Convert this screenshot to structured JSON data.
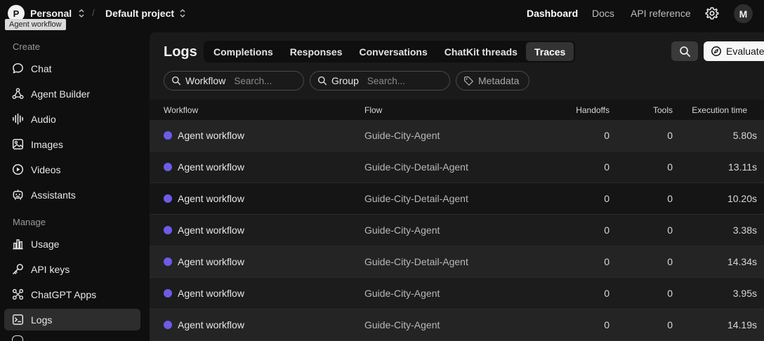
{
  "topbar": {
    "org_initial": "P",
    "org_name": "Personal",
    "project_name": "Default project",
    "tooltip": "Agent workflow",
    "nav": {
      "dashboard": "Dashboard",
      "docs": "Docs",
      "api_reference": "API reference"
    },
    "user_initial": "M"
  },
  "sidebar": {
    "create_title": "Create",
    "create_items": [
      {
        "label": "Chat",
        "icon": "chat-bubble-icon"
      },
      {
        "label": "Agent Builder",
        "icon": "agent-builder-icon"
      },
      {
        "label": "Audio",
        "icon": "audio-wave-icon"
      },
      {
        "label": "Images",
        "icon": "image-icon"
      },
      {
        "label": "Videos",
        "icon": "play-circle-icon"
      },
      {
        "label": "Assistants",
        "icon": "robot-icon"
      }
    ],
    "manage_title": "Manage",
    "manage_items": [
      {
        "label": "Usage",
        "icon": "bar-chart-icon"
      },
      {
        "label": "API keys",
        "icon": "key-icon"
      },
      {
        "label": "ChatGPT Apps",
        "icon": "apps-icon"
      },
      {
        "label": "Logs",
        "icon": "terminal-icon",
        "active": true
      }
    ]
  },
  "main": {
    "title": "Logs",
    "tabs": [
      {
        "label": "Completions"
      },
      {
        "label": "Responses"
      },
      {
        "label": "Conversations"
      },
      {
        "label": "ChatKit threads"
      },
      {
        "label": "Traces",
        "active": true
      }
    ],
    "evaluate_label": "Evaluate",
    "filters": {
      "workflow": {
        "label": "Workflow",
        "placeholder": "Search..."
      },
      "group": {
        "label": "Group",
        "placeholder": "Search..."
      },
      "metadata": {
        "label": "Metadata"
      }
    },
    "columns": {
      "workflow": "Workflow",
      "flow": "Flow",
      "handoffs": "Handoffs",
      "tools": "Tools",
      "execution_time": "Execution time"
    },
    "rows": [
      {
        "workflow": "Agent workflow",
        "flow": "Guide-City-Agent",
        "handoffs": "0",
        "tools": "0",
        "time": "5.80s"
      },
      {
        "workflow": "Agent workflow",
        "flow": "Guide-City-Detail-Agent",
        "handoffs": "0",
        "tools": "0",
        "time": "13.11s"
      },
      {
        "workflow": "Agent workflow",
        "flow": "Guide-City-Detail-Agent",
        "handoffs": "0",
        "tools": "0",
        "time": "10.20s"
      },
      {
        "workflow": "Agent workflow",
        "flow": "Guide-City-Agent",
        "handoffs": "0",
        "tools": "0",
        "time": "3.38s"
      },
      {
        "workflow": "Agent workflow",
        "flow": "Guide-City-Detail-Agent",
        "handoffs": "0",
        "tools": "0",
        "time": "14.34s"
      },
      {
        "workflow": "Agent workflow",
        "flow": "Guide-City-Agent",
        "handoffs": "0",
        "tools": "0",
        "time": "3.95s"
      },
      {
        "workflow": "Agent workflow",
        "flow": "Guide-City-Agent",
        "handoffs": "0",
        "tools": "0",
        "time": "14.19s"
      }
    ],
    "status_dot_color": "#6c5ce7"
  }
}
